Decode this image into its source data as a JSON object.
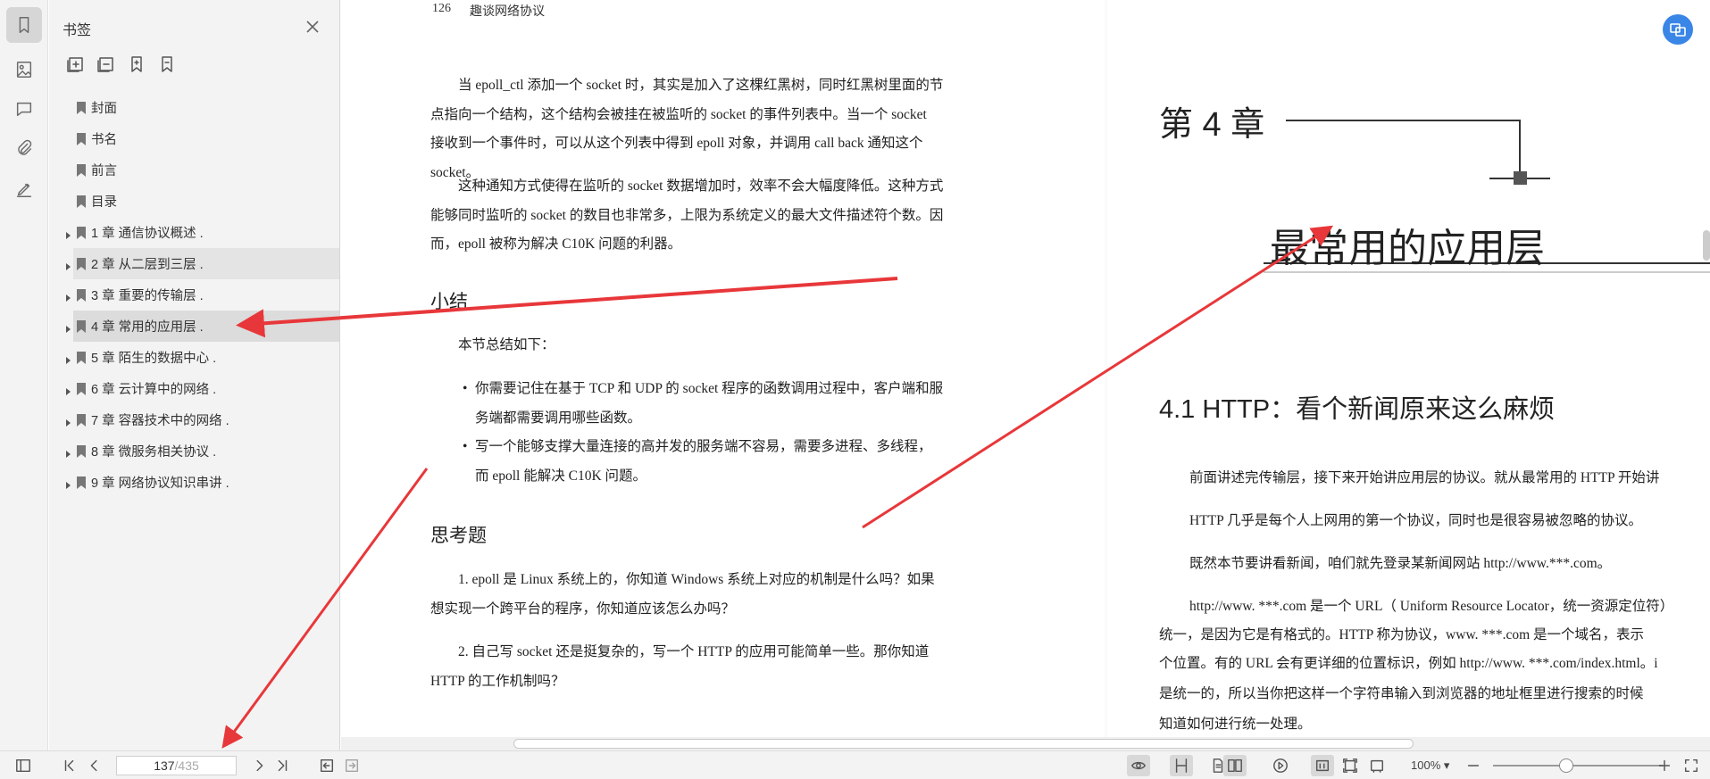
{
  "panel": {
    "title": "书签",
    "items": [
      {
        "label": "封面",
        "expandable": false,
        "state": ""
      },
      {
        "label": "书名",
        "expandable": false,
        "state": ""
      },
      {
        "label": "前言",
        "expandable": false,
        "state": ""
      },
      {
        "label": "目录",
        "expandable": false,
        "state": ""
      },
      {
        "label": "1 章 通信协议概述 .",
        "expandable": true,
        "state": ""
      },
      {
        "label": "2 章 从二层到三层 .",
        "expandable": true,
        "state": "hover"
      },
      {
        "label": "3 章 重要的传输层 .",
        "expandable": true,
        "state": ""
      },
      {
        "label": "4 章 常用的应用层 .",
        "expandable": true,
        "state": "selected"
      },
      {
        "label": "5 章 陌生的数据中心 .",
        "expandable": true,
        "state": ""
      },
      {
        "label": "6 章 云计算中的网络 .",
        "expandable": true,
        "state": ""
      },
      {
        "label": "7 章 容器技术中的网络 .",
        "expandable": true,
        "state": ""
      },
      {
        "label": "8 章 微服务相关协议 .",
        "expandable": true,
        "state": ""
      },
      {
        "label": "9 章 网络协议知识串讲 .",
        "expandable": true,
        "state": ""
      }
    ]
  },
  "left_page": {
    "page_number": "126",
    "running_title": "趣谈网络协议",
    "para1": "当 epoll_ctl 添加一个 socket 时，其实是加入了这棵红黑树，同时红黑树里面的节点指向一个结构，这个结构会被挂在被监听的 socket 的事件列表中。当一个 socket 接收到一个事件时，可以从这个列表中得到 epoll 对象，并调用 call back 通知这个 socket。",
    "para2": "这种通知方式使得在监听的 socket 数据增加时，效率不会大幅度降低。这种方式能够同时监听的 socket 的数目也非常多，上限为系统定义的最大文件描述符个数。因而，epoll 被称为解决 C10K 问题的利器。",
    "summary_heading": "小结",
    "summary_intro": "本节总结如下：",
    "bullets": [
      "你需要记住在基于 TCP 和 UDP 的 socket 程序的函数调用过程中，客户端和服务端都需要调用哪些函数。",
      "写一个能够支撑大量连接的高并发的服务端不容易，需要多进程、多线程，而 epoll 能解决 C10K 问题。"
    ],
    "questions_heading": "思考题",
    "questions": [
      "1.  epoll 是 Linux 系统上的，你知道 Windows 系统上对应的机制是什么吗？如果想实现一个跨平台的程序，你知道应该怎么办吗？",
      "2.  自己写 socket 还是挺复杂的，写一个 HTTP 的应用可能简单一些。那你知道 HTTP 的工作机制吗？"
    ]
  },
  "right_page": {
    "chapter_label": "第 4 章",
    "chapter_title": "最常用的应用层",
    "section_title": "4.1   HTTP：看个新闻原来这么麻烦",
    "lines": [
      "前面讲述完传输层，接下来开始讲应用层的协议。就从最常用的 HTTP 开始讲",
      "HTTP 几乎是每个人上网用的第一个协议，同时也是很容易被忽略的协议。",
      "既然本节要讲看新闻，咱们就先登录某新闻网站 http://www.***.com。",
      "http://www. ***.com 是一个 URL（ Uniform Resource Locator，统一资源定位符）",
      "统一，是因为它是有格式的。HTTP 称为协议，www. ***.com 是一个域名，表示",
      "个位置。有的 URL 会有更详细的位置标识，例如 http://www. ***.com/index.html。i",
      "是统一的，所以当你把这样一个字符串输入到浏览器的地址框里进行搜索的时候",
      "知道如何进行统一处理。"
    ]
  },
  "toolbar": {
    "current_page": "137",
    "total_pages": "/435",
    "zoom": "100%"
  },
  "colors": {
    "annotation_arrow": "#e8373a",
    "accent": "#3a86e6"
  }
}
